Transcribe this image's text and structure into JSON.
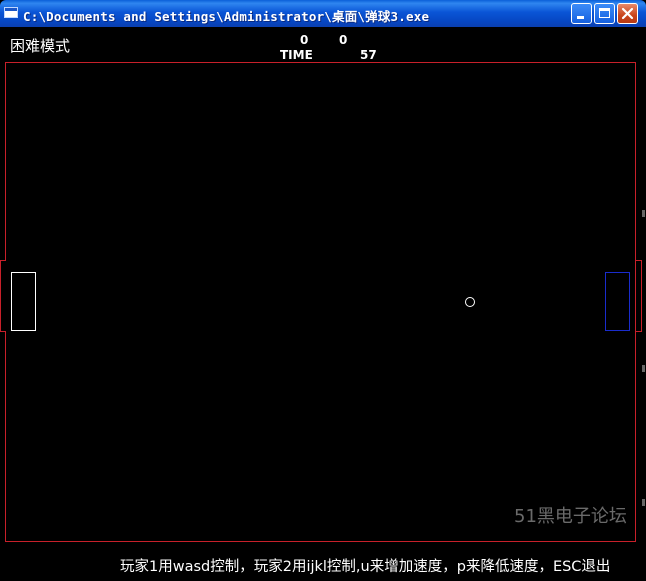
{
  "window": {
    "title": "C:\\Documents and Settings\\Administrator\\桌面\\弹球3.exe",
    "icon": "console-window-icon",
    "controls": [
      "minimize-icon",
      "maximize-icon",
      "close-icon"
    ]
  },
  "hud": {
    "mode": "困难模式",
    "score_player1": "0",
    "score_player2": "0",
    "time_label": "TIME",
    "time_value": "57"
  },
  "footer": {
    "instructions": "玩家1用wasd控制，玩家2用ijkl控制,u来增加速度，p来降低速度，ESC退出",
    "watermark": "51黑电子论坛"
  },
  "colors": {
    "background": "#000000",
    "court_border": "#c8202a",
    "paddle_player1": "#ffffff",
    "paddle_player2": "#1a2ccc",
    "ball": "#ffffff",
    "titlebar": "#0a55d6"
  }
}
